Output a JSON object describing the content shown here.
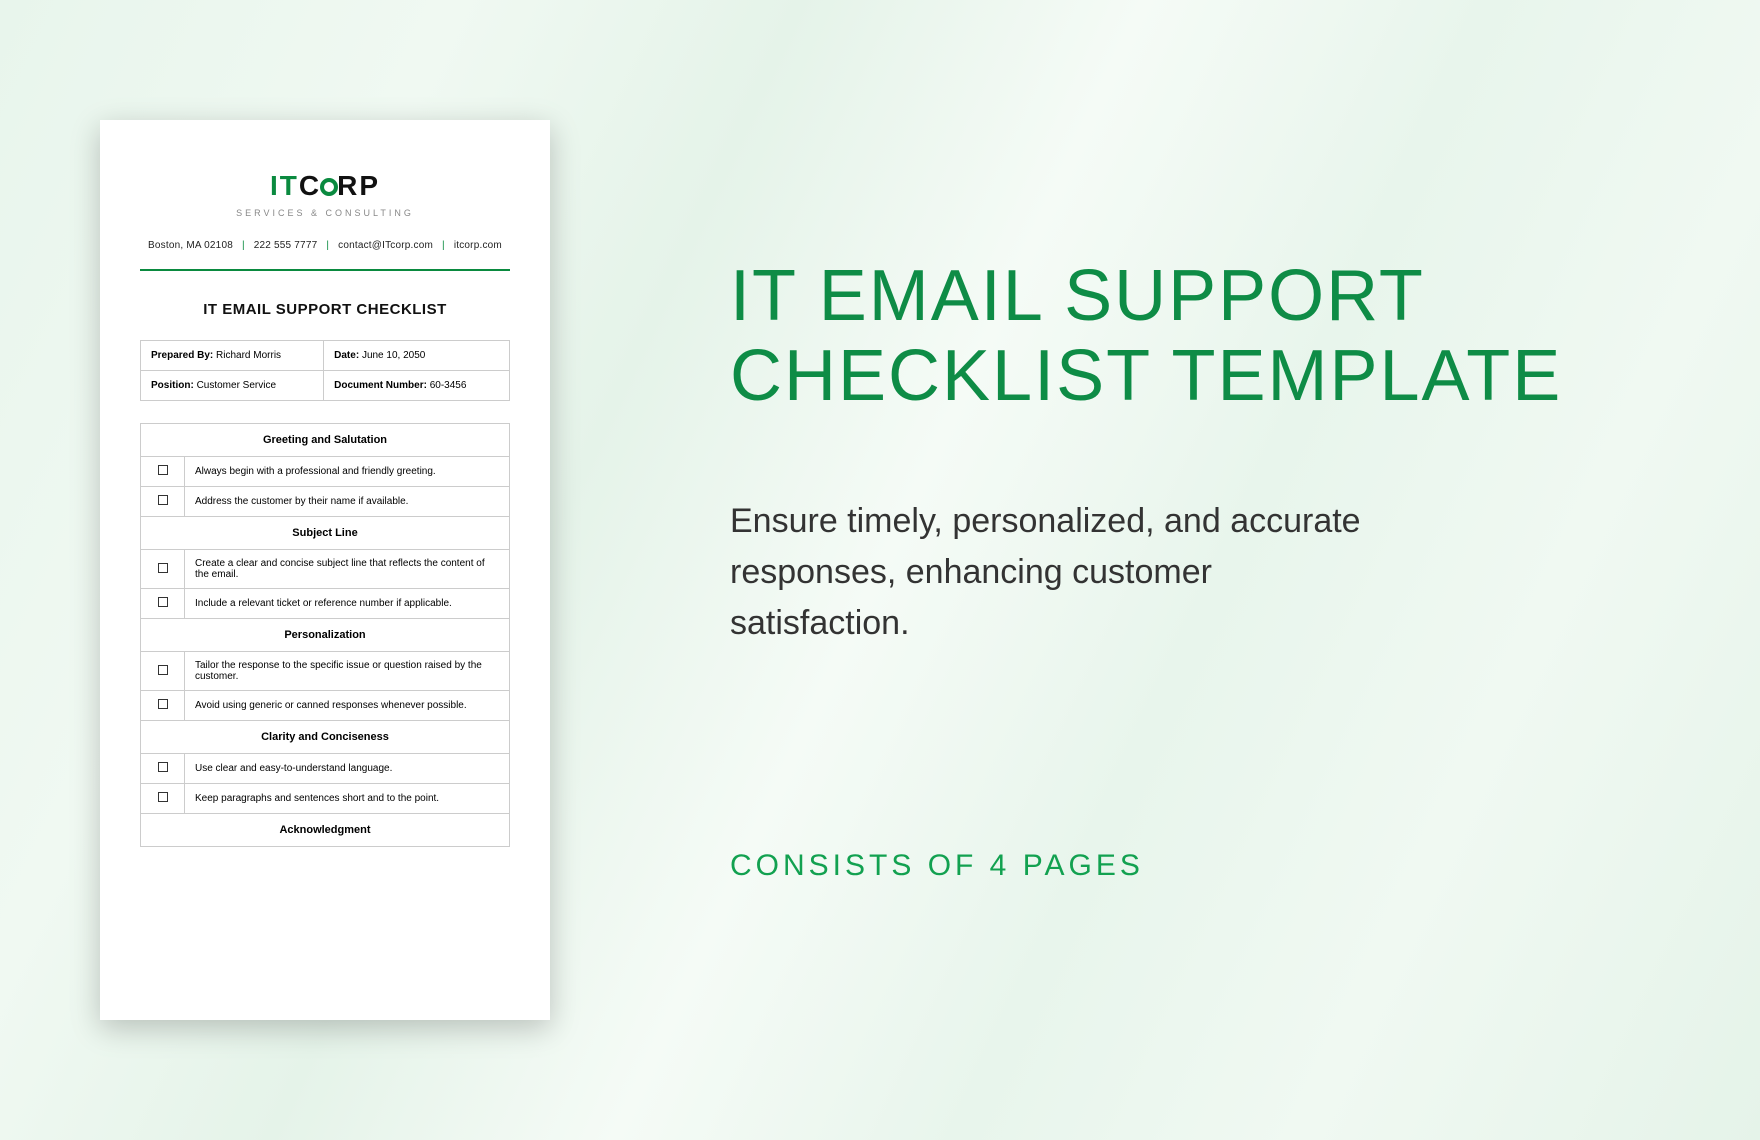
{
  "doc": {
    "logo_it": "IT",
    "logo_c": "C",
    "logo_rp": "RP",
    "tagline": "SERVICES & CONSULTING",
    "addr": "Boston, MA 02108",
    "phone": "222 555 7777",
    "email": "contact@ITcorp.com",
    "site": "itcorp.com",
    "title": "IT EMAIL SUPPORT CHECKLIST",
    "meta": {
      "prepared_label": "Prepared By:",
      "prepared_value": "Richard Morris",
      "date_label": "Date:",
      "date_value": "June 10, 2050",
      "position_label": "Position:",
      "position_value": "Customer Service",
      "docnum_label": "Document Number:",
      "docnum_value": "60-3456"
    },
    "sections": {
      "s1": "Greeting and Salutation",
      "s1i1": "Always begin with a professional and friendly greeting.",
      "s1i2": "Address the customer by their name if available.",
      "s2": "Subject Line",
      "s2i1": "Create a clear and concise subject line that reflects the content of the email.",
      "s2i2": "Include a relevant ticket or reference number if applicable.",
      "s3": "Personalization",
      "s3i1": "Tailor the response to the specific issue or question raised by the customer.",
      "s3i2": "Avoid using generic or canned responses whenever possible.",
      "s4": "Clarity and Conciseness",
      "s4i1": "Use clear and easy-to-understand language.",
      "s4i2": "Keep paragraphs and sentences short and to the point.",
      "s5": "Acknowledgment"
    }
  },
  "promo": {
    "title": "IT EMAIL SUPPORT CHECKLIST TEMPLATE",
    "desc": "Ensure timely, personalized, and accurate responses, enhancing customer satisfaction.",
    "consists": "CONSISTS OF 4 PAGES"
  }
}
